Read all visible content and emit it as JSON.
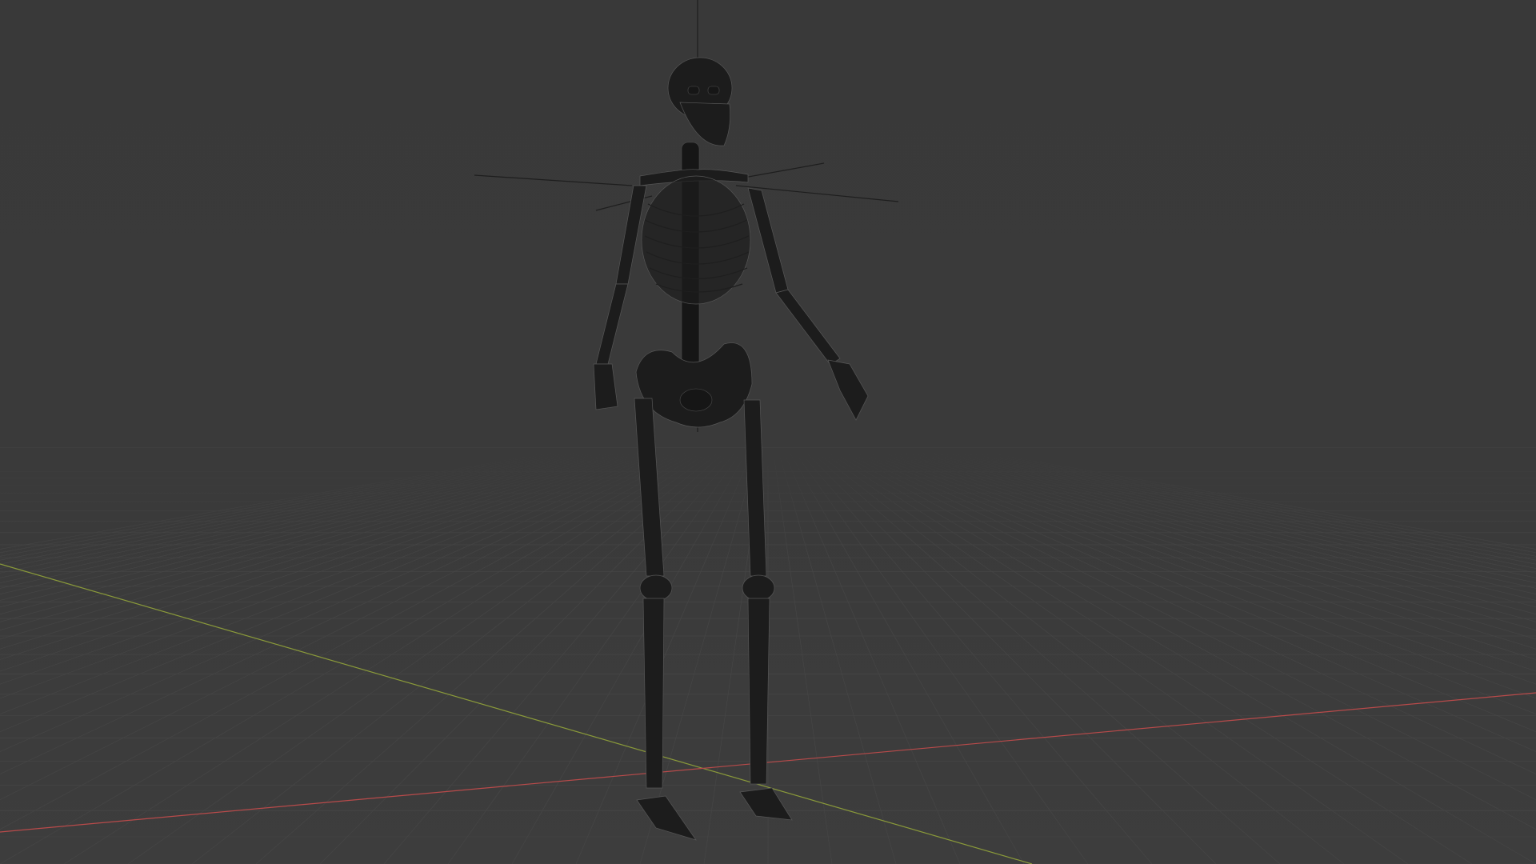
{
  "viewport": {
    "background_color": "#3a3a3a",
    "shading_mode": "wireframe",
    "floor_grid": true,
    "axis_x_color": "#b84a4a",
    "axis_y_color": "#8a9a3a",
    "object_shown": "skeleton"
  }
}
